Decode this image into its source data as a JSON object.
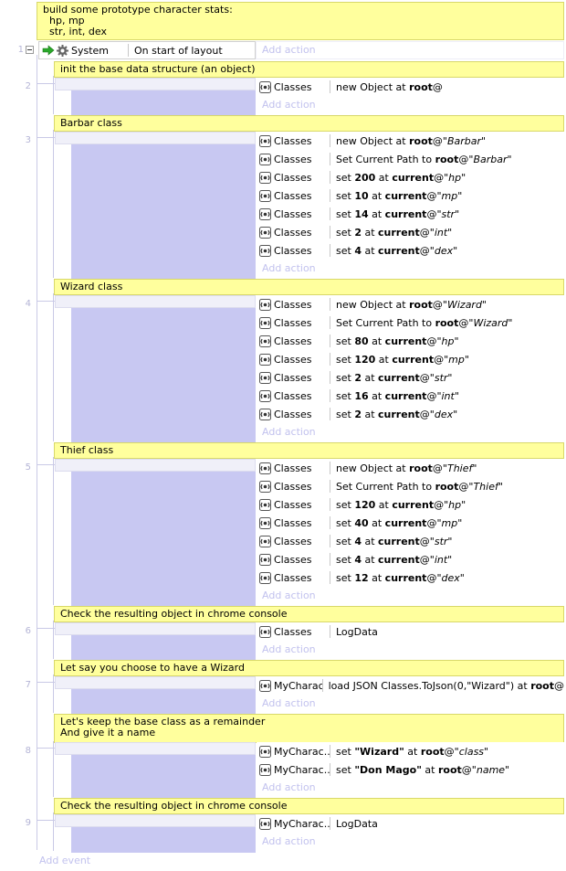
{
  "top_comment": "build some prototype character stats:\n  hp, mp\n  str, int, dex",
  "main_event": {
    "number": "1",
    "object": "System",
    "condition": "On start of layout",
    "add_action": "Add action"
  },
  "groups": [
    {
      "number": "2",
      "comment": "init the base data structure (an object)",
      "actions": [
        {
          "object": "Classes",
          "parts": [
            {
              "t": "new Object at "
            },
            {
              "t": "root",
              "b": true
            },
            {
              "t": "@"
            }
          ]
        }
      ],
      "add_action": "Add action"
    },
    {
      "number": "3",
      "comment": "Barbar class",
      "actions": [
        {
          "object": "Classes",
          "parts": [
            {
              "t": "new Object at "
            },
            {
              "t": "root",
              "b": true
            },
            {
              "t": "@"
            },
            {
              "t": "\"Barbar\"",
              "i": true
            }
          ]
        },
        {
          "object": "Classes",
          "parts": [
            {
              "t": "Set Current Path to "
            },
            {
              "t": "root",
              "b": true
            },
            {
              "t": "@"
            },
            {
              "t": "\"Barbar\"",
              "i": true
            }
          ]
        },
        {
          "object": "Classes",
          "parts": [
            {
              "t": "set "
            },
            {
              "t": "200",
              "b": true
            },
            {
              "t": " at "
            },
            {
              "t": "current",
              "b": true
            },
            {
              "t": "@"
            },
            {
              "t": "\"hp\"",
              "i": true
            }
          ]
        },
        {
          "object": "Classes",
          "parts": [
            {
              "t": "set "
            },
            {
              "t": "10",
              "b": true
            },
            {
              "t": " at "
            },
            {
              "t": "current",
              "b": true
            },
            {
              "t": "@"
            },
            {
              "t": "\"mp\"",
              "i": true
            }
          ]
        },
        {
          "object": "Classes",
          "parts": [
            {
              "t": "set "
            },
            {
              "t": "14",
              "b": true
            },
            {
              "t": " at "
            },
            {
              "t": "current",
              "b": true
            },
            {
              "t": "@"
            },
            {
              "t": "\"str\"",
              "i": true
            }
          ]
        },
        {
          "object": "Classes",
          "parts": [
            {
              "t": "set "
            },
            {
              "t": "2",
              "b": true
            },
            {
              "t": " at "
            },
            {
              "t": "current",
              "b": true
            },
            {
              "t": "@"
            },
            {
              "t": "\"int\"",
              "i": true
            }
          ]
        },
        {
          "object": "Classes",
          "parts": [
            {
              "t": "set "
            },
            {
              "t": "4",
              "b": true
            },
            {
              "t": " at "
            },
            {
              "t": "current",
              "b": true
            },
            {
              "t": "@"
            },
            {
              "t": "\"dex\"",
              "i": true
            }
          ]
        }
      ],
      "add_action": "Add action"
    },
    {
      "number": "4",
      "comment": "Wizard class",
      "actions": [
        {
          "object": "Classes",
          "parts": [
            {
              "t": "new Object at "
            },
            {
              "t": "root",
              "b": true
            },
            {
              "t": "@"
            },
            {
              "t": "\"Wizard\"",
              "i": true
            }
          ]
        },
        {
          "object": "Classes",
          "parts": [
            {
              "t": "Set Current Path to "
            },
            {
              "t": "root",
              "b": true
            },
            {
              "t": "@"
            },
            {
              "t": "\"Wizard\"",
              "i": true
            }
          ]
        },
        {
          "object": "Classes",
          "parts": [
            {
              "t": "set "
            },
            {
              "t": "80",
              "b": true
            },
            {
              "t": " at "
            },
            {
              "t": "current",
              "b": true
            },
            {
              "t": "@"
            },
            {
              "t": "\"hp\"",
              "i": true
            }
          ]
        },
        {
          "object": "Classes",
          "parts": [
            {
              "t": "set "
            },
            {
              "t": "120",
              "b": true
            },
            {
              "t": " at "
            },
            {
              "t": "current",
              "b": true
            },
            {
              "t": "@"
            },
            {
              "t": "\"mp\"",
              "i": true
            }
          ]
        },
        {
          "object": "Classes",
          "parts": [
            {
              "t": "set "
            },
            {
              "t": "2",
              "b": true
            },
            {
              "t": " at "
            },
            {
              "t": "current",
              "b": true
            },
            {
              "t": "@"
            },
            {
              "t": "\"str\"",
              "i": true
            }
          ]
        },
        {
          "object": "Classes",
          "parts": [
            {
              "t": "set "
            },
            {
              "t": "16",
              "b": true
            },
            {
              "t": " at "
            },
            {
              "t": "current",
              "b": true
            },
            {
              "t": "@"
            },
            {
              "t": "\"int\"",
              "i": true
            }
          ]
        },
        {
          "object": "Classes",
          "parts": [
            {
              "t": "set "
            },
            {
              "t": "2",
              "b": true
            },
            {
              "t": " at "
            },
            {
              "t": "current",
              "b": true
            },
            {
              "t": "@"
            },
            {
              "t": "\"dex\"",
              "i": true
            }
          ]
        }
      ],
      "add_action": "Add action"
    },
    {
      "number": "5",
      "comment": "Thief class",
      "actions": [
        {
          "object": "Classes",
          "parts": [
            {
              "t": "new Object at "
            },
            {
              "t": "root",
              "b": true
            },
            {
              "t": "@"
            },
            {
              "t": "\"Thief\"",
              "i": true
            }
          ]
        },
        {
          "object": "Classes",
          "parts": [
            {
              "t": "Set Current Path to "
            },
            {
              "t": "root",
              "b": true
            },
            {
              "t": "@"
            },
            {
              "t": "\"Thief\"",
              "i": true
            }
          ]
        },
        {
          "object": "Classes",
          "parts": [
            {
              "t": "set "
            },
            {
              "t": "120",
              "b": true
            },
            {
              "t": " at "
            },
            {
              "t": "current",
              "b": true
            },
            {
              "t": "@"
            },
            {
              "t": "\"hp\"",
              "i": true
            }
          ]
        },
        {
          "object": "Classes",
          "parts": [
            {
              "t": "set "
            },
            {
              "t": "40",
              "b": true
            },
            {
              "t": " at "
            },
            {
              "t": "current",
              "b": true
            },
            {
              "t": "@"
            },
            {
              "t": "\"mp\"",
              "i": true
            }
          ]
        },
        {
          "object": "Classes",
          "parts": [
            {
              "t": "set "
            },
            {
              "t": "4",
              "b": true
            },
            {
              "t": " at "
            },
            {
              "t": "current",
              "b": true
            },
            {
              "t": "@"
            },
            {
              "t": "\"str\"",
              "i": true
            }
          ]
        },
        {
          "object": "Classes",
          "parts": [
            {
              "t": "set "
            },
            {
              "t": "4",
              "b": true
            },
            {
              "t": " at "
            },
            {
              "t": "current",
              "b": true
            },
            {
              "t": "@"
            },
            {
              "t": "\"int\"",
              "i": true
            }
          ]
        },
        {
          "object": "Classes",
          "parts": [
            {
              "t": "set "
            },
            {
              "t": "12",
              "b": true
            },
            {
              "t": " at "
            },
            {
              "t": "current",
              "b": true
            },
            {
              "t": "@"
            },
            {
              "t": "\"dex\"",
              "i": true
            }
          ]
        }
      ],
      "add_action": "Add action"
    },
    {
      "number": "6",
      "comment": "Check the resulting object in chrome console",
      "actions": [
        {
          "object": "Classes",
          "parts": [
            {
              "t": "LogData"
            }
          ]
        }
      ],
      "add_action": "Add action"
    },
    {
      "number": "7",
      "comment": "Let say you choose to have a Wizard",
      "actions": [
        {
          "object": "MyCharac...",
          "parts": [
            {
              "t": "load JSON Classes.ToJson(0,\"Wizard\") at "
            },
            {
              "t": "root",
              "b": true
            },
            {
              "t": "@"
            }
          ]
        }
      ],
      "add_action": "Add action"
    },
    {
      "number": "8",
      "comment": "Let's keep the base class as a remainder\nAnd give it a name",
      "actions": [
        {
          "object": "MyCharac...",
          "parts": [
            {
              "t": "set "
            },
            {
              "t": "\"Wizard\"",
              "b": true
            },
            {
              "t": " at "
            },
            {
              "t": "root",
              "b": true
            },
            {
              "t": "@"
            },
            {
              "t": "\"class\"",
              "i": true
            }
          ]
        },
        {
          "object": "MyCharac...",
          "parts": [
            {
              "t": "set "
            },
            {
              "t": "\"Don Mago\"",
              "b": true
            },
            {
              "t": " at "
            },
            {
              "t": "root",
              "b": true
            },
            {
              "t": "@"
            },
            {
              "t": "\"name\"",
              "i": true
            }
          ]
        }
      ],
      "add_action": "Add action"
    },
    {
      "number": "9",
      "comment": "Check the resulting object in chrome console",
      "actions": [
        {
          "object": "MyCharac...",
          "parts": [
            {
              "t": "LogData"
            }
          ]
        }
      ],
      "add_action": "Add action"
    }
  ],
  "add_event": "Add event",
  "colors": {
    "comment_bg": "#ffff9d",
    "condition_area": "#c8c8f2",
    "placeholder_text": "#c2c2ee",
    "line_number": "#b4b4d6"
  }
}
